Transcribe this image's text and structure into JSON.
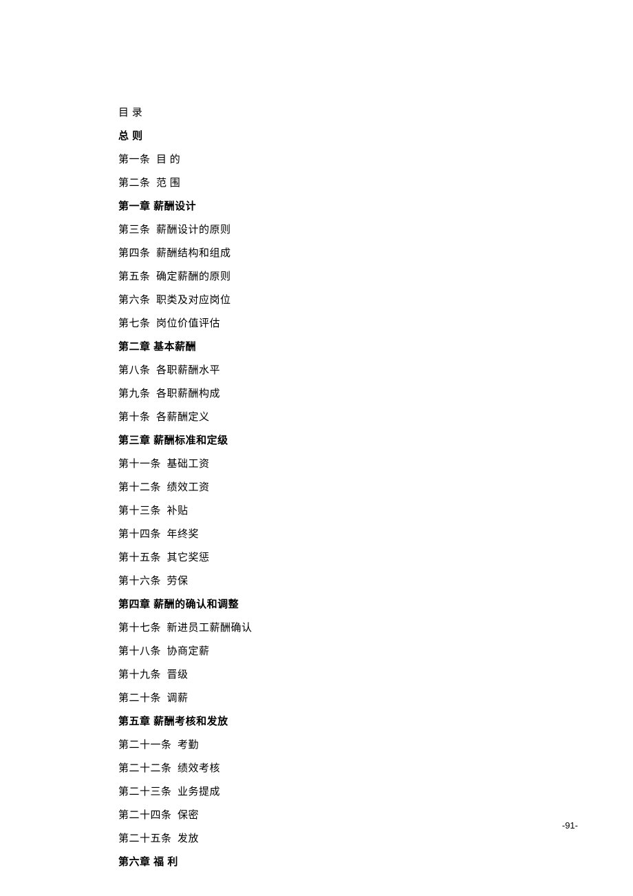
{
  "toc": {
    "header": "目 录",
    "section_general": "总  则",
    "items": [
      {
        "label": "第一条",
        "title": "目  的",
        "bold": false
      },
      {
        "label": "第二条",
        "title": "范  围",
        "bold": false
      }
    ],
    "chapter1_header": "第一章  薪酬设计",
    "chapter1_items": [
      {
        "label": "第三条",
        "title": "薪酬设计的原则"
      },
      {
        "label": "第四条",
        "title": "薪酬结构和组成"
      },
      {
        "label": "第五条",
        "title": "确定薪酬的原则"
      },
      {
        "label": "第六条",
        "title": "职类及对应岗位"
      },
      {
        "label": "第七条",
        "title": "岗位价值评估"
      }
    ],
    "chapter2_header": "第二章  基本薪酬",
    "chapter2_items": [
      {
        "label": "第八条",
        "title": "各职薪酬水平"
      },
      {
        "label": "第九条",
        "title": "各职薪酬构成"
      },
      {
        "label": "第十条",
        "title": "各薪酬定义"
      }
    ],
    "chapter3_header": "第三章  薪酬标准和定级",
    "chapter3_items": [
      {
        "label": "第十一条",
        "title": "基础工资"
      },
      {
        "label": "第十二条",
        "title": "绩效工资"
      },
      {
        "label": "第十三条",
        "title": "补贴"
      },
      {
        "label": "第十四条",
        "title": "年终奖"
      },
      {
        "label": "第十五条",
        "title": "其它奖惩"
      },
      {
        "label": "第十六条",
        "title": "劳保"
      }
    ],
    "chapter4_header": "第四章  薪酬的确认和调整",
    "chapter4_items": [
      {
        "label": "第十七条",
        "title": "新进员工薪酬确认"
      },
      {
        "label": "第十八条",
        "title": "协商定薪"
      },
      {
        "label": "第十九条",
        "title": "晋级"
      },
      {
        "label": "第二十条",
        "title": "调薪"
      }
    ],
    "chapter5_header": "第五章  薪酬考核和发放",
    "chapter5_items": [
      {
        "label": "第二十一条",
        "title": "考勤"
      },
      {
        "label": "第二十二条",
        "title": "绩效考核"
      },
      {
        "label": "第二十三条",
        "title": "业务提成"
      },
      {
        "label": "第二十四条",
        "title": "保密"
      },
      {
        "label": "第二十五条",
        "title": "发放"
      }
    ],
    "chapter6_header": "第六章  福  利"
  },
  "page_number": "-91-"
}
